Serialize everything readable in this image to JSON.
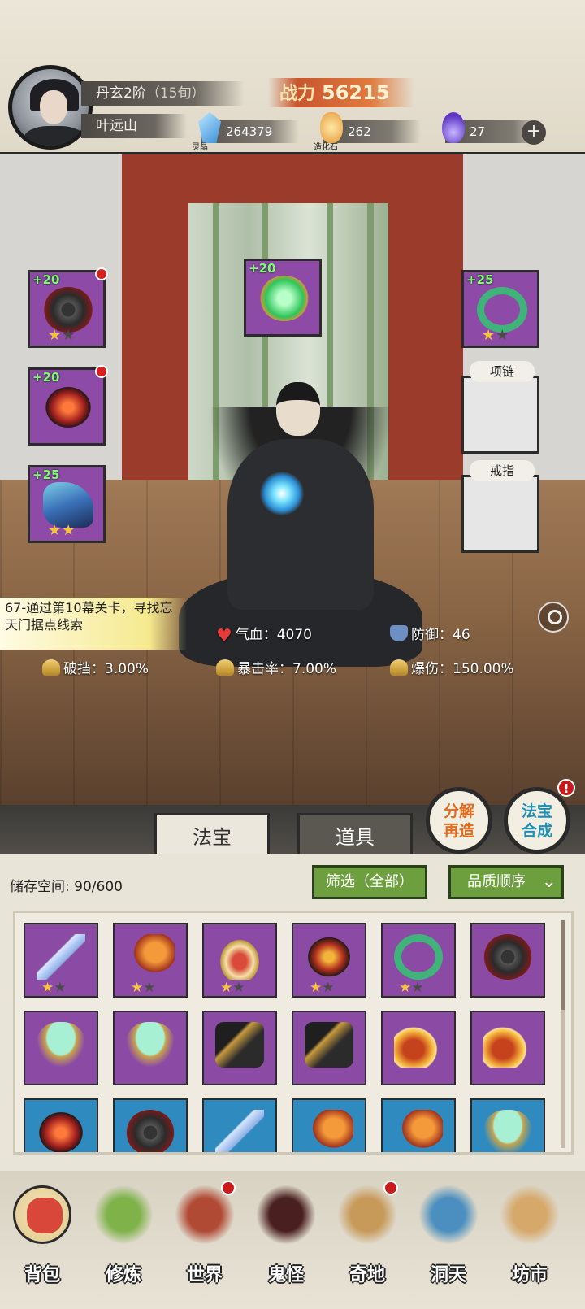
{
  "header": {
    "rank": "丹玄2阶",
    "rank_suffix": "（15旬）",
    "player_name": "叶远山",
    "power_label": "战力",
    "power_value": "56215",
    "resources": [
      {
        "name": "灵晶",
        "value": "264379",
        "icon": "crystal-icon"
      },
      {
        "name": "造化石",
        "value": "262",
        "icon": "stone-icon"
      },
      {
        "name": "",
        "value": "27",
        "icon": "flame-icon"
      }
    ],
    "add_label": "+"
  },
  "equipment": {
    "left": [
      {
        "level": "+20",
        "stars": 1,
        "max_stars": 2,
        "art": "wheel",
        "alert": true
      },
      {
        "level": "+20",
        "stars": 0,
        "max_stars": 0,
        "art": "demon",
        "alert": true
      },
      {
        "level": "+25",
        "stars": 2,
        "max_stars": 2,
        "art": "boot",
        "alert": false
      }
    ],
    "center": {
      "level": "+20",
      "art": "orb"
    },
    "right": [
      {
        "level": "+25",
        "stars": 1,
        "max_stars": 2,
        "art": "wreath"
      }
    ],
    "empty_slots": [
      {
        "label": "项链"
      },
      {
        "label": "戒指"
      }
    ]
  },
  "quest": {
    "text": "67-通过第10幕关卡，寻找忘天门据点线索"
  },
  "stats": {
    "hp": {
      "label": "气血：",
      "value": "4070"
    },
    "defense": {
      "label": "防御：",
      "value": "46"
    },
    "block": {
      "label": "破挡：",
      "value": "3.00%"
    },
    "crit_rate": {
      "label": "暴击率：",
      "value": "7.00%"
    },
    "crit_damage": {
      "label": "爆伤：",
      "value": "150.00%"
    }
  },
  "tabs": {
    "fabao": "法宝",
    "daoju": "道具"
  },
  "actions": {
    "decompose": [
      "分解",
      "再造"
    ],
    "synthesize": [
      "法宝",
      "合成"
    ],
    "synth_badge": "!"
  },
  "inventory": {
    "storage_label": "储存空间:",
    "storage_value": "90/600",
    "filter_label": "筛选（全部）",
    "sort_label": "品质顺序",
    "items": [
      {
        "art": "sword",
        "stars": 1,
        "max_stars": 2,
        "rarity": "purple"
      },
      {
        "art": "axe",
        "stars": 1,
        "max_stars": 2,
        "rarity": "purple"
      },
      {
        "art": "fan",
        "stars": 1,
        "max_stars": 2,
        "rarity": "purple"
      },
      {
        "art": "mask",
        "stars": 1,
        "max_stars": 2,
        "rarity": "purple"
      },
      {
        "art": "wreath",
        "stars": 1,
        "max_stars": 2,
        "rarity": "purple"
      },
      {
        "art": "wheel",
        "stars": 0,
        "max_stars": 0,
        "rarity": "purple"
      },
      {
        "art": "mirror",
        "stars": 0,
        "max_stars": 0,
        "rarity": "purple"
      },
      {
        "art": "mirror",
        "stars": 0,
        "max_stars": 0,
        "rarity": "purple"
      },
      {
        "art": "bracer",
        "stars": 0,
        "max_stars": 0,
        "rarity": "purple"
      },
      {
        "art": "bracer",
        "stars": 0,
        "max_stars": 0,
        "rarity": "purple"
      },
      {
        "art": "wing",
        "stars": 0,
        "max_stars": 0,
        "rarity": "purple"
      },
      {
        "art": "wing",
        "stars": 0,
        "max_stars": 0,
        "rarity": "purple"
      },
      {
        "art": "demon",
        "stars": 0,
        "max_stars": 0,
        "rarity": "blue"
      },
      {
        "art": "wheel",
        "stars": 0,
        "max_stars": 0,
        "rarity": "blue"
      },
      {
        "art": "sword",
        "stars": 0,
        "max_stars": 0,
        "rarity": "blue"
      },
      {
        "art": "axe",
        "stars": 0,
        "max_stars": 0,
        "rarity": "blue"
      },
      {
        "art": "axe",
        "stars": 0,
        "max_stars": 0,
        "rarity": "blue"
      },
      {
        "art": "mirror",
        "stars": 0,
        "max_stars": 0,
        "rarity": "blue"
      }
    ]
  },
  "nav": [
    {
      "label": "背包",
      "icon": "bag-icon",
      "color": "#d9463a",
      "active": true,
      "alert": false
    },
    {
      "label": "修炼",
      "icon": "lotus-icon",
      "color": "#7fb34a",
      "active": false,
      "alert": false
    },
    {
      "label": "世界",
      "icon": "scroll-icon",
      "color": "#b04a34",
      "active": false,
      "alert": true
    },
    {
      "label": "鬼怪",
      "icon": "egg-icon",
      "color": "#4a1f1f",
      "active": false,
      "alert": false
    },
    {
      "label": "奇地",
      "icon": "palace-icon",
      "color": "#c89a5a",
      "active": false,
      "alert": true
    },
    {
      "label": "洞天",
      "icon": "portal-icon",
      "color": "#4a8fbf",
      "active": false,
      "alert": false
    },
    {
      "label": "坊市",
      "icon": "market-icon",
      "color": "#d6a86a",
      "active": false,
      "alert": false
    }
  ]
}
